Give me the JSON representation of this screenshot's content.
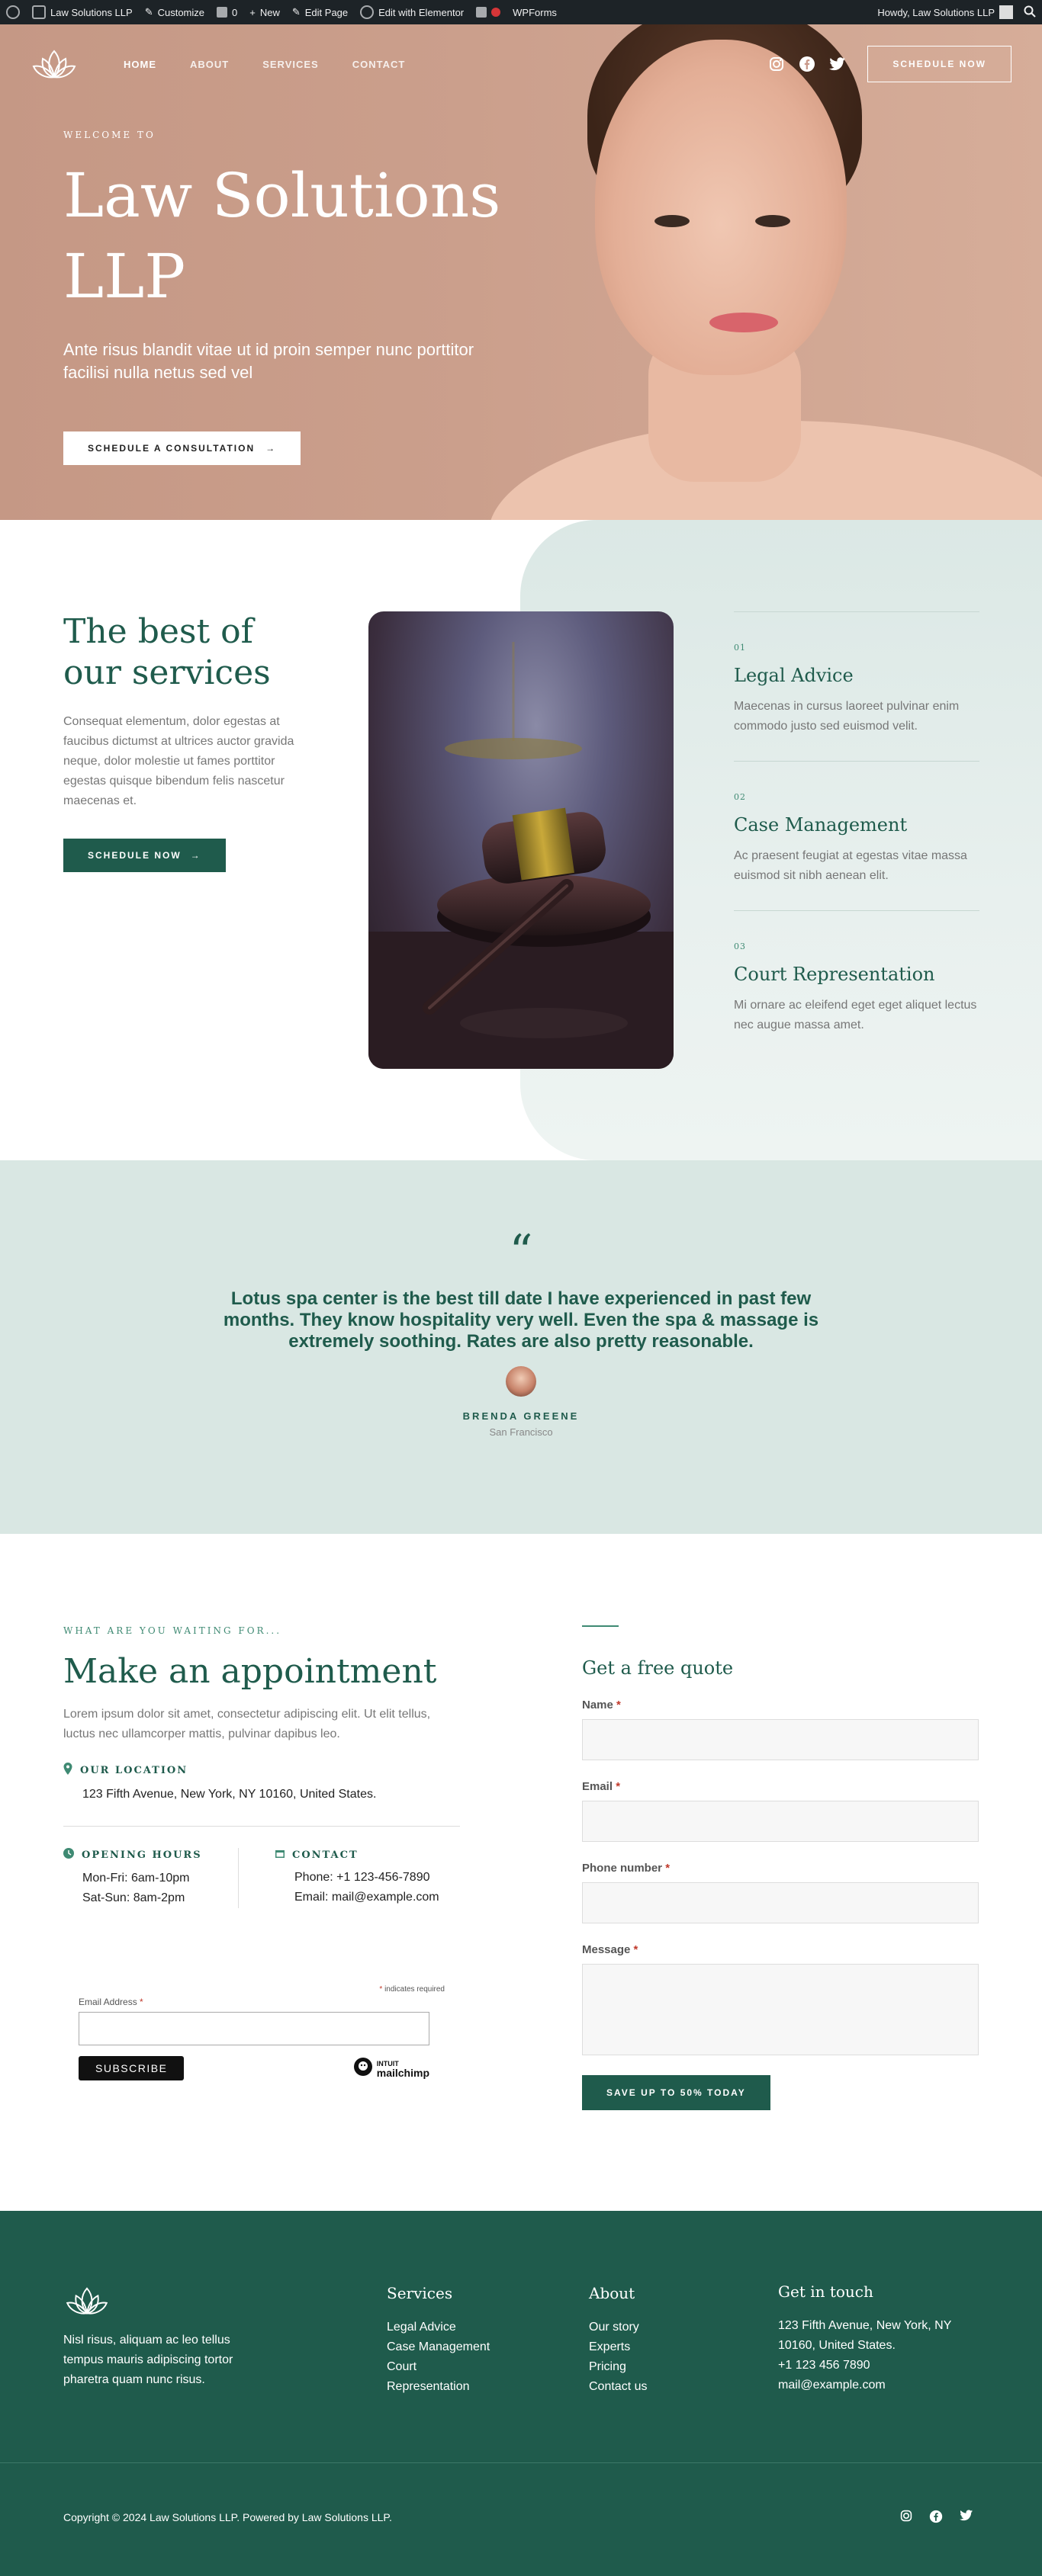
{
  "adminbar": {
    "site": "Law Solutions LLP",
    "customize": "Customize",
    "comments": "0",
    "new": "New",
    "edit_page": "Edit Page",
    "elementor": "Edit with Elementor",
    "wpforms": "WPForms",
    "howdy": "Howdy, Law Solutions LLP"
  },
  "nav": {
    "items": [
      "HOME",
      "ABOUT",
      "SERVICES",
      "CONTACT"
    ],
    "cta": "SCHEDULE NOW",
    "social": [
      "instagram-icon",
      "facebook-icon",
      "twitter-icon"
    ]
  },
  "hero": {
    "eyebrow": "WELCOME TO",
    "title_line1": "Law Solutions",
    "title_line2": "LLP",
    "subtitle": "Ante risus blandit vitae ut id proin semper nunc porttitor facilisi nulla netus sed vel",
    "cta": "SCHEDULE A CONSULTATION"
  },
  "services": {
    "title_line1": "The best of",
    "title_line2": "our services",
    "text": "Consequat elementum, dolor egestas at faucibus dictumst at ultrices auctor gravida neque, dolor molestie ut fames porttitor egestas quisque bibendum felis nascetur maecenas et.",
    "cta": "SCHEDULE NOW",
    "items": [
      {
        "num": "01",
        "title": "Legal Advice",
        "text": "Maecenas in cursus laoreet pulvinar enim commodo justo sed euismod velit."
      },
      {
        "num": "02",
        "title": "Case Management",
        "text": "Ac praesent feugiat at egestas vitae massa euismod sit nibh aenean elit."
      },
      {
        "num": "03",
        "title": "Court Representation",
        "text": "Mi ornare ac eleifend eget eget aliquet lectus nec augue massa amet."
      }
    ]
  },
  "testimonial": {
    "mark": "“",
    "quote": "Lotus spa center is the best till date I have experienced in past few months. They know hospitality very well. Even the spa & massage is extremely soothing. Rates are also pretty reasonable.",
    "name": "BRENDA GREENE",
    "location": "San Francisco"
  },
  "appointment": {
    "eyebrow": "WHAT ARE YOU WAITING FOR...",
    "title": "Make an appointment",
    "text": "Lorem ipsum dolor sit amet, consectetur adipiscing elit. Ut elit tellus, luctus nec ullamcorper mattis, pulvinar dapibus leo.",
    "location_label": "OUR LOCATION",
    "location": "123 Fifth Avenue, New York, NY 10160, United States.",
    "hours_label": "OPENING HOURS",
    "hours1": "Mon-Fri: 6am-10pm",
    "hours2": "Sat-Sun: 8am-2pm",
    "contact_label": "CONTACT",
    "phone": "Phone: +1 123-456-7890",
    "email": "Email: mail@example.com",
    "mc_required": "indicates required",
    "mc_email_label": "Email Address",
    "mc_subscribe": "SUBSCRIBE",
    "mc_brand_top": "INTUIT",
    "mc_brand": "mailchimp"
  },
  "quote_form": {
    "title": "Get a free quote",
    "name_label": "Name",
    "email_label": "Email",
    "phone_label": "Phone number",
    "message_label": "Message",
    "required": "*",
    "submit": "SAVE UP TO 50% TODAY"
  },
  "footer": {
    "about_text": "Nisl risus, aliquam ac leo tellus tempus mauris adipiscing tortor pharetra quam nunc risus.",
    "services_title": "Services",
    "services": [
      "Legal Advice",
      "Case Management",
      "Court",
      "Representation"
    ],
    "about_title": "About",
    "about_links": [
      "Our story",
      "Experts",
      "Pricing",
      "Contact us"
    ],
    "touch_title": "Get in touch",
    "touch": [
      "123 Fifth Avenue, New York, NY",
      "10160, United States.",
      "+1 123 456 7890",
      "mail@example.com"
    ],
    "copyright": "Copyright © 2024 Law Solutions LLP. Powered by Law Solutions LLP."
  },
  "colors": {
    "primary": "#1f5b4c",
    "hero_bg": "#c9998a",
    "soft": "#d9e7e3"
  }
}
